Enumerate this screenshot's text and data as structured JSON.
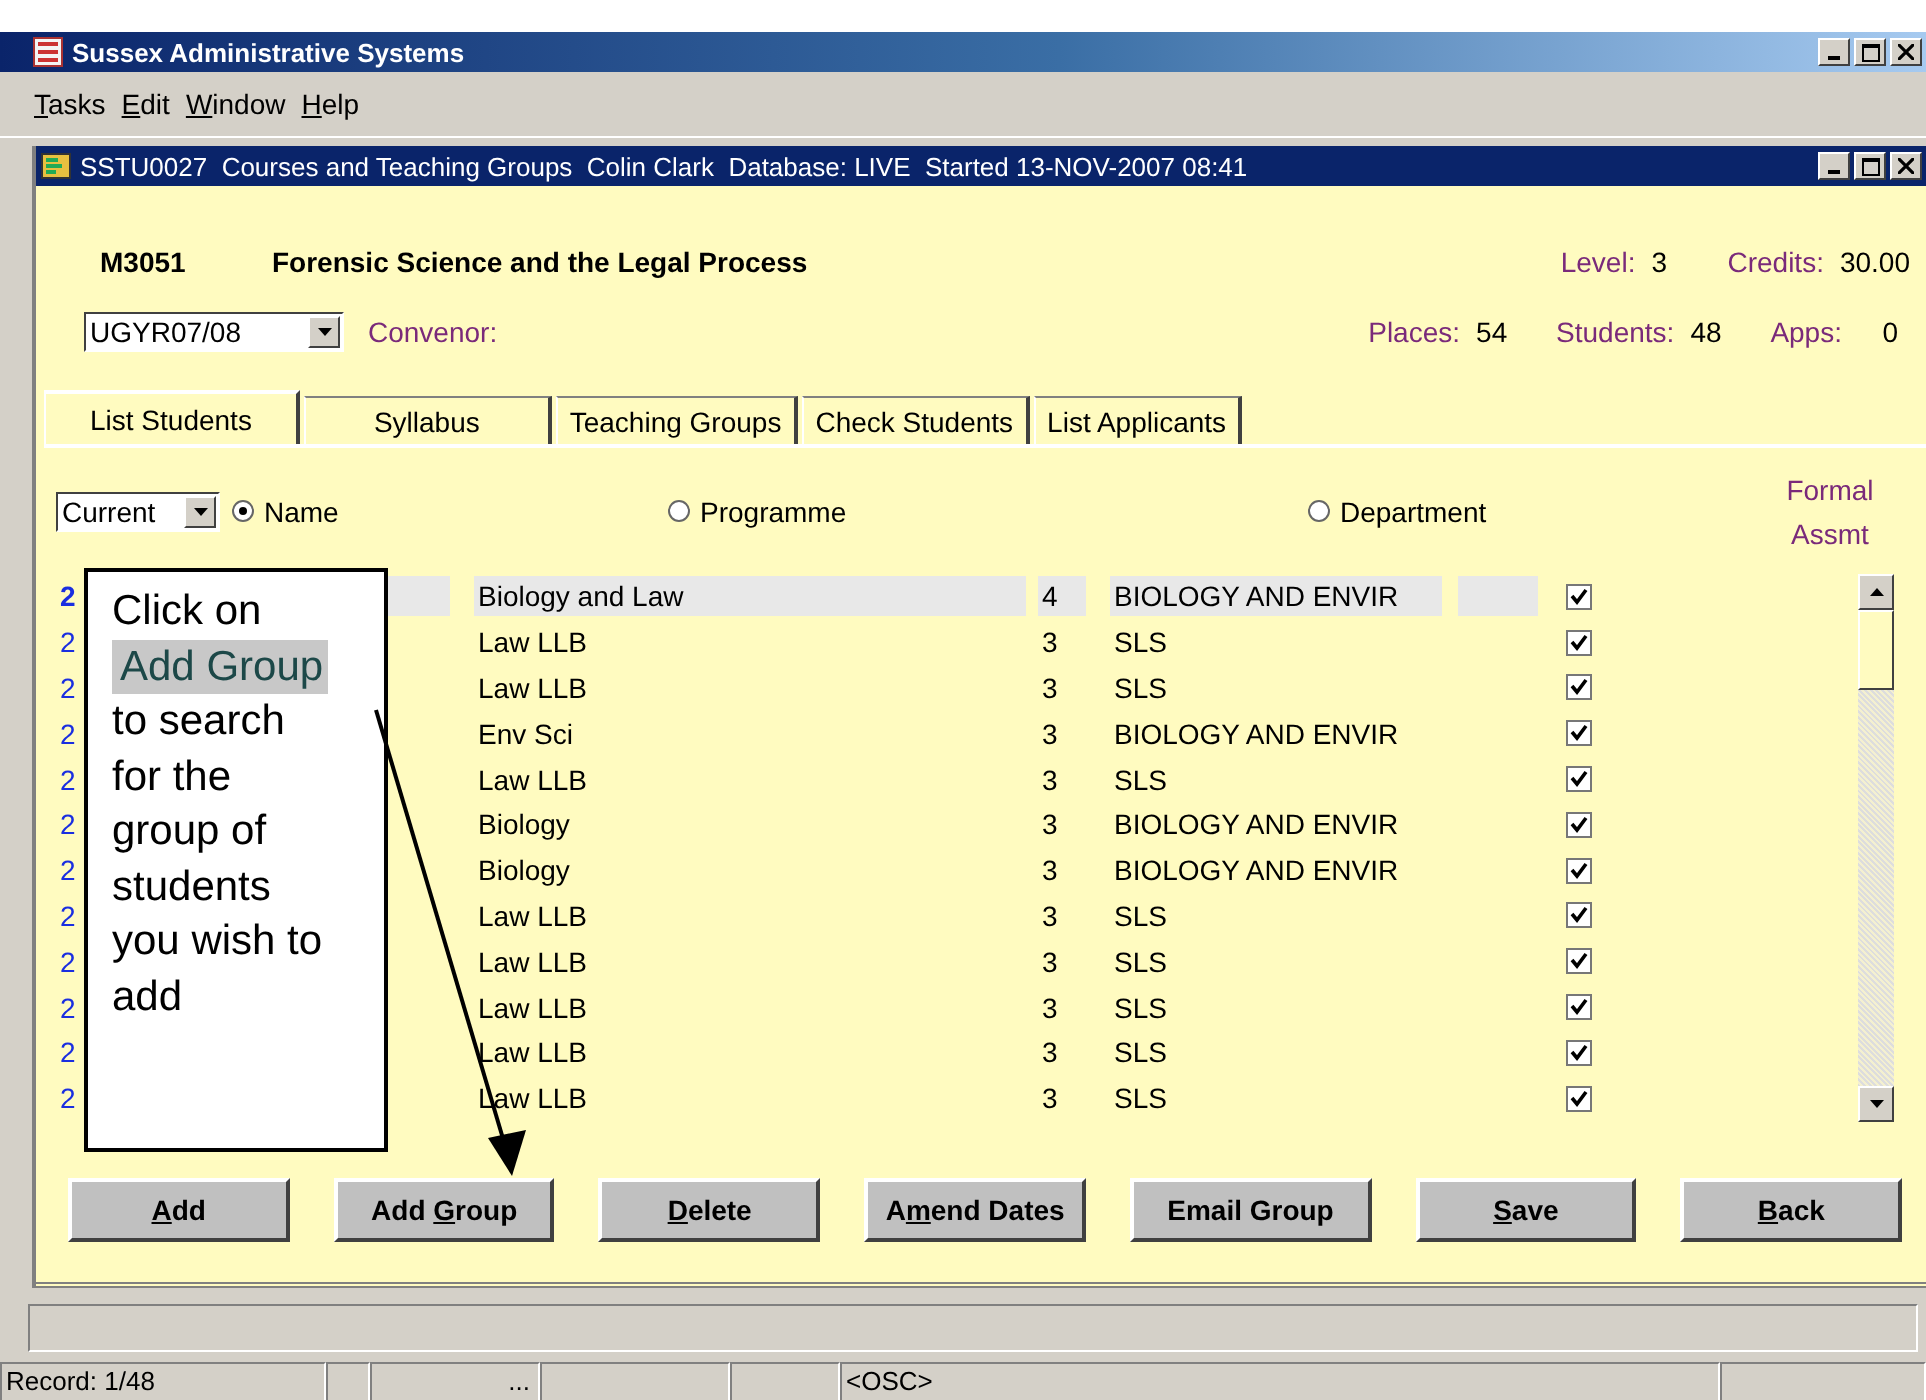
{
  "app_window": {
    "title": "Sussex Administrative Systems"
  },
  "menu": [
    [
      {
        "text": "T",
        "underline": true
      },
      {
        "text": "asks",
        "underline": false
      }
    ],
    [
      {
        "text": "E",
        "underline": true
      },
      {
        "text": "dit",
        "underline": false
      }
    ],
    [
      {
        "text": "W",
        "underline": true
      },
      {
        "text": "indow",
        "underline": false
      }
    ],
    [
      {
        "text": "H",
        "underline": true
      },
      {
        "text": "elp",
        "underline": false
      }
    ]
  ],
  "form_window": {
    "title": "SSTU0027  Courses and Teaching Groups  Colin Clark  Database: LIVE  Started 13-NOV-2007 08:41"
  },
  "course": {
    "code": "M3051",
    "title": "Forensic Science and the Legal Process",
    "level_label": "Level:",
    "level": "3",
    "credits_label": "Credits:",
    "credits": "30.00",
    "year": "UGYR07/08",
    "convenor_label": "Convenor:",
    "places_label": "Places:",
    "places": "54",
    "students_label": "Students:",
    "students": "48",
    "apps_label": "Apps:",
    "apps": "0"
  },
  "tabs": [
    {
      "label": "List Students",
      "selected": true
    },
    {
      "label": "Syllabus",
      "selected": false
    },
    {
      "label": "Teaching Groups",
      "selected": false
    },
    {
      "label": "Check Students",
      "selected": false
    },
    {
      "label": "List Applicants",
      "selected": false
    }
  ],
  "filter": {
    "value": "Current"
  },
  "sort_options": [
    {
      "label": "Name",
      "selected": true
    },
    {
      "label": "Programme",
      "selected": false
    },
    {
      "label": "Department",
      "selected": false
    }
  ],
  "formal_assmt_header": "Formal Assmt",
  "rows": [
    {
      "number": "2",
      "programme": "Biology and Law",
      "level": "4",
      "department": "BIOLOGY AND ENVIR",
      "checked": true,
      "selected": true
    },
    {
      "number": "2",
      "programme": "Law LLB",
      "level": "3",
      "department": "SLS",
      "checked": true,
      "selected": false
    },
    {
      "number": "2",
      "programme": "Law LLB",
      "level": "3",
      "department": "SLS",
      "checked": true,
      "selected": false
    },
    {
      "number": "2",
      "programme": "Env Sci",
      "level": "3",
      "department": "BIOLOGY AND ENVIR",
      "checked": true,
      "selected": false
    },
    {
      "number": "2",
      "programme": "Law LLB",
      "level": "3",
      "department": "SLS",
      "checked": true,
      "selected": false
    },
    {
      "number": "2",
      "programme": "Biology",
      "level": "3",
      "department": "BIOLOGY AND ENVIR",
      "checked": true,
      "selected": false
    },
    {
      "number": "2",
      "programme": "Biology",
      "level": "3",
      "department": "BIOLOGY AND ENVIR",
      "checked": true,
      "selected": false
    },
    {
      "number": "2",
      "programme": "Law LLB",
      "level": "3",
      "department": "SLS",
      "checked": true,
      "selected": false
    },
    {
      "number": "2",
      "programme": "Law LLB",
      "level": "3",
      "department": "SLS",
      "checked": true,
      "selected": false
    },
    {
      "number": "2",
      "programme": "Law LLB",
      "level": "3",
      "department": "SLS",
      "checked": true,
      "selected": false
    },
    {
      "number": "2",
      "programme": "Law LLB",
      "level": "3",
      "department": "SLS",
      "checked": true,
      "selected": false
    },
    {
      "number": "2",
      "programme": "Law LLB",
      "level": "3",
      "department": "SLS",
      "checked": true,
      "selected": false
    }
  ],
  "buttons": [
    [
      {
        "text": "A",
        "underline": true
      },
      {
        "text": "dd",
        "underline": false
      }
    ],
    [
      {
        "text": "Add ",
        "underline": false
      },
      {
        "text": "G",
        "underline": true
      },
      {
        "text": "roup",
        "underline": false
      }
    ],
    [
      {
        "text": "D",
        "underline": true
      },
      {
        "text": "elete",
        "underline": false
      }
    ],
    [
      {
        "text": "A",
        "underline": false
      },
      {
        "text": "m",
        "underline": true
      },
      {
        "text": "end Dates",
        "underline": false
      }
    ],
    [
      {
        "text": "Email Group",
        "underline": false
      }
    ],
    [
      {
        "text": "S",
        "underline": true
      },
      {
        "text": "ave",
        "underline": false
      }
    ],
    [
      {
        "text": "B",
        "underline": true
      },
      {
        "text": "ack",
        "underline": false
      }
    ]
  ],
  "callout": {
    "lead": "Click on",
    "highlight": "Add Group",
    "rest": "to search for the group of students you wish to add"
  },
  "status_bar": [
    {
      "kind": "text",
      "text": "Record: 1/48"
    },
    {
      "kind": "empty"
    },
    {
      "kind": "text",
      "text": "..."
    },
    {
      "kind": "empty"
    },
    {
      "kind": "empty"
    },
    {
      "kind": "text",
      "text": "<OSC>"
    },
    {
      "kind": "empty"
    }
  ]
}
